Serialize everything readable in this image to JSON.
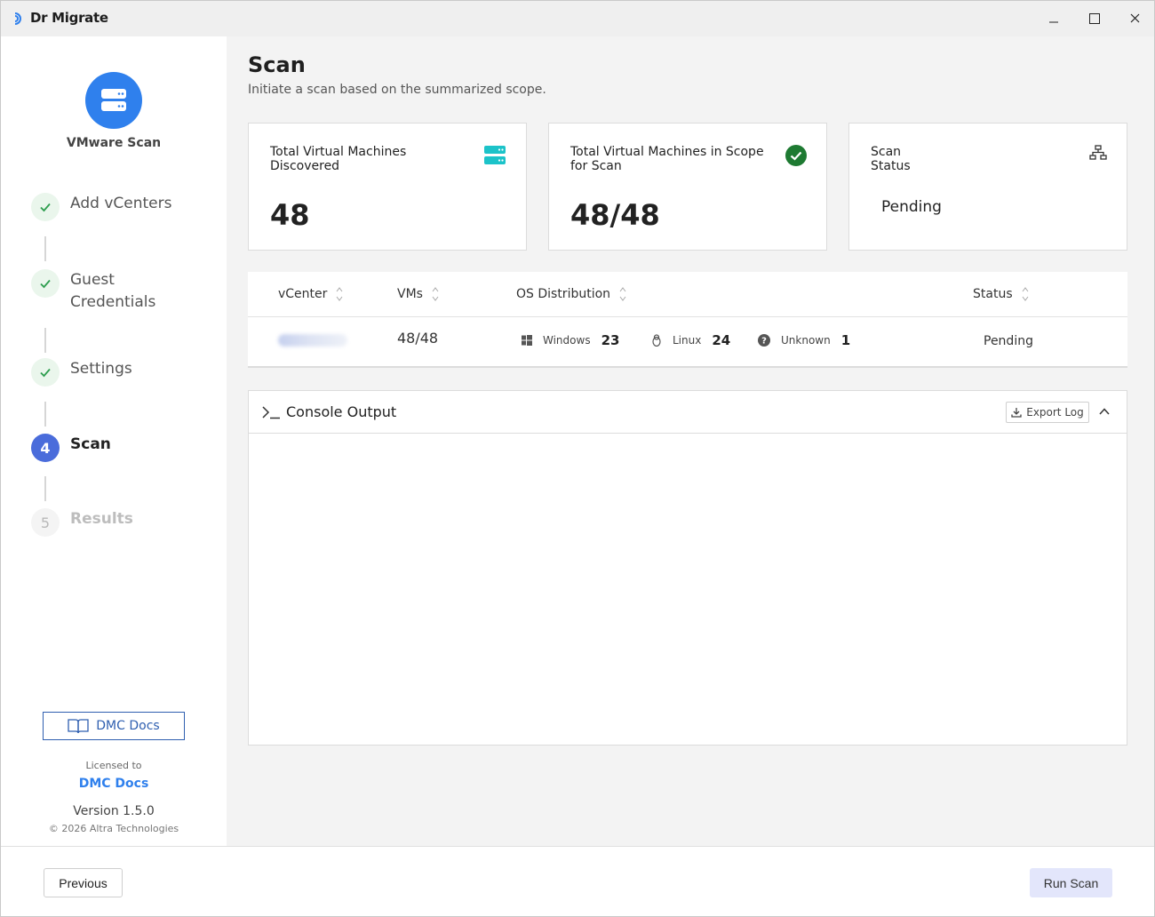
{
  "window": {
    "title": "Dr Migrate",
    "controls": [
      "minimize-icon",
      "maximize-icon",
      "close-icon"
    ]
  },
  "sidebar": {
    "app_name": "VMware Scan",
    "app_icon": "server-icon",
    "steps": [
      {
        "label": "Add vCenters",
        "state": "done"
      },
      {
        "label": "Guest Credentials",
        "state": "done"
      },
      {
        "label": "Settings",
        "state": "done"
      },
      {
        "number": "4",
        "label": "Scan",
        "state": "active"
      },
      {
        "number": "5",
        "label": "Results",
        "state": "todo"
      }
    ],
    "docs_button": "DMC Docs",
    "licensed_to_label": "Licensed to",
    "licensee": "DMC Docs",
    "version": "Version 1.5.0",
    "copyright": "© 2026 Altra Technologies"
  },
  "main": {
    "title": "Scan",
    "subtitle": "Initiate a scan based on the summarized scope.",
    "cards": [
      {
        "label": "Total Virtual Machines Discovered",
        "value": "48",
        "icon": "server-icon"
      },
      {
        "label": "Total Virtual Machines in Scope for Scan",
        "value": "48/48",
        "icon": "check-circle-icon"
      },
      {
        "label": "Scan Status",
        "value": "Pending",
        "icon": "network-icon"
      }
    ],
    "table": {
      "columns": [
        "vCenter",
        "VMs",
        "OS Distribution",
        "Status"
      ],
      "rows": [
        {
          "vcenter": "",
          "vms": "48/48",
          "os": [
            {
              "name": "Windows",
              "count": "23",
              "icon": "windows-icon"
            },
            {
              "name": "Linux",
              "count": "24",
              "icon": "linux-icon"
            },
            {
              "name": "Unknown",
              "count": "1",
              "icon": "question-icon"
            }
          ],
          "status": "Pending"
        }
      ]
    },
    "console": {
      "title": "Console Output",
      "export_label": "Export Log",
      "content": ""
    }
  },
  "footer": {
    "previous": "Previous",
    "run": "Run Scan"
  },
  "colors": {
    "accent_blue": "#2f80ed",
    "active_step": "#4a6cdb",
    "success_green": "#1e8a3a",
    "teal": "#1cc3c9",
    "run_button_bg": "#e3e6fb"
  }
}
